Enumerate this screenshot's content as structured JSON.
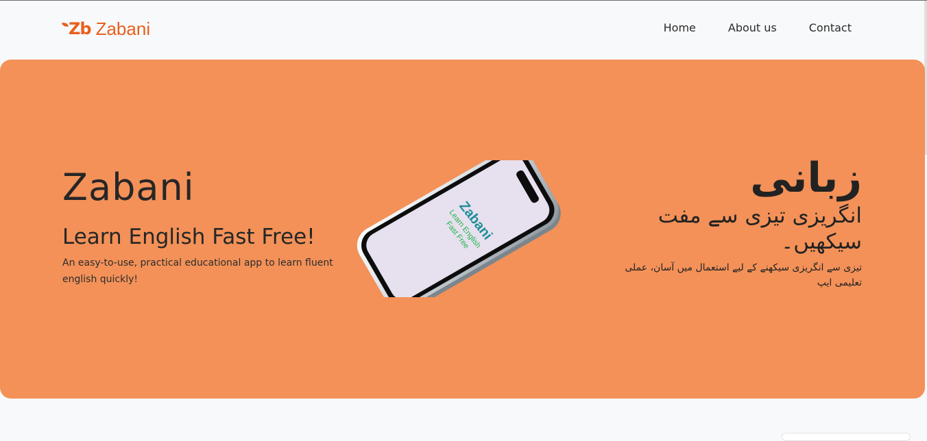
{
  "header": {
    "logo_mark": "Zb",
    "logo_text": "Zabani",
    "nav": [
      "Home",
      "About us",
      "Contact"
    ]
  },
  "hero": {
    "title": "Zabani",
    "subtitle": "Learn English Fast Free!",
    "description": "An easy-to-use, practical educational app to learn fluent english quickly!",
    "phone_screen": {
      "title": "Zabani",
      "line1": "Learn English",
      "line2": "Fast Free"
    },
    "urdu_title": "زبانی",
    "urdu_subtitle": "انگریزی تیزی سے مفت سیکھیں۔",
    "urdu_description": "تیزی سے انگریزی سیکھنے کے لیے استعمال میں آسان، عملی تعلیمی ایپ"
  },
  "colors": {
    "accent": "#e8601c",
    "hero_background": "#f39158",
    "page_background": "#f8f9fb",
    "phone_title": "#1d8f99",
    "phone_tagline": "#1fb64a"
  }
}
